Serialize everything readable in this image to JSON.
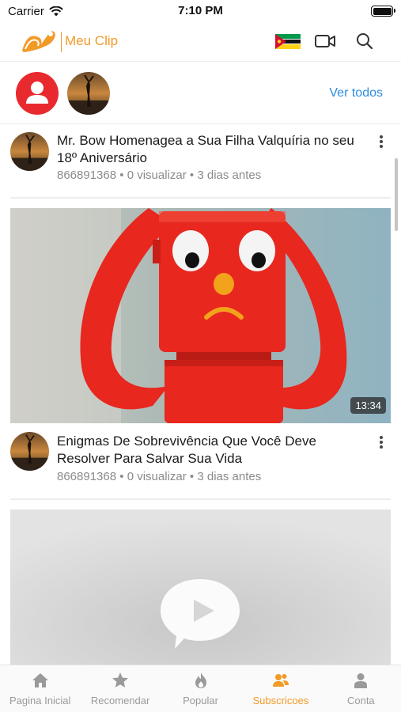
{
  "status_bar": {
    "carrier": "Carrier",
    "time": "7:10 PM"
  },
  "header": {
    "app_name": "Meu Clip",
    "logo_text": "Meu Clip",
    "flag_icon": "mozambique-flag-icon",
    "camera_icon": "video-camera-icon",
    "search_icon": "search-icon"
  },
  "subscriptions": {
    "see_all_label": "Ver todos"
  },
  "videos": [
    {
      "title": "Mr. Bow Homenagea a Sua Filha Valquíria no seu 18º Aniversário",
      "channel": "866891368",
      "views": "0 visualizar",
      "age": "3 dias antes"
    },
    {
      "title": "Enigmas De Sobrevivência Que Você Deve Resolver Para Salvar Sua Vida",
      "channel": "866891368",
      "views": "0 visualizar",
      "age": "3 dias antes",
      "duration": "13:34"
    }
  ],
  "separator": "•",
  "tabs": [
    {
      "label": "Pagina Inicial",
      "icon": "home-icon"
    },
    {
      "label": "Recomendar",
      "icon": "star-icon"
    },
    {
      "label": "Popular",
      "icon": "flame-icon"
    },
    {
      "label": "Subscricoes",
      "icon": "subscriptions-icon",
      "active": true
    },
    {
      "label": "Conta",
      "icon": "account-icon"
    }
  ],
  "colors": {
    "accent": "#f29a27",
    "link": "#2d8ee0",
    "avatar_red": "#e82a2f",
    "thumb_red": "#e8271e"
  }
}
